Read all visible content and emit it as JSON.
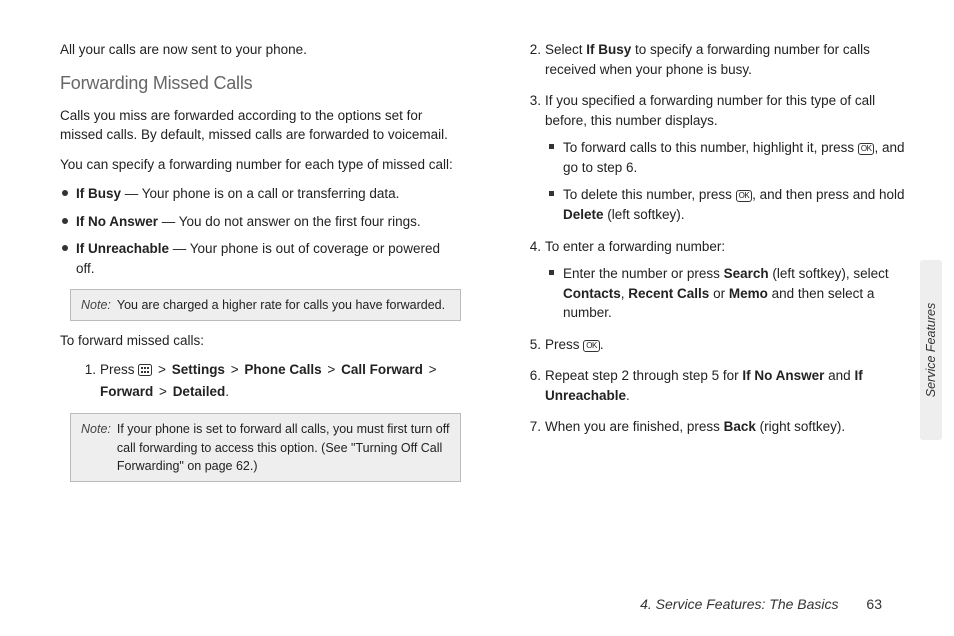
{
  "left": {
    "intro_sent": "All your calls are now sent to your phone.",
    "heading": "Forwarding Missed Calls",
    "p1": "Calls you miss are forwarded according to the options set for missed calls. By default, missed calls are forwarded to voicemail.",
    "p2": "You can specify a forwarding number for each type of missed call:",
    "b_busy_lbl": "If Busy",
    "b_busy_txt": " — Your phone is on a call or transferring data.",
    "b_noans_lbl": "If No Answer",
    "b_noans_txt": " — You do not answer on the first four rings.",
    "b_unr_lbl": "If Unreachable",
    "b_unr_txt": " — Your phone is out of coverage or powered off.",
    "note1_label": "Note:",
    "note1_text": "You are charged a higher rate for calls you have forwarded.",
    "instr": "To forward missed calls:",
    "step1_pre": "Press ",
    "nav_settings": "Settings",
    "nav_phonecalls": "Phone Calls",
    "nav_callfwd": "Call Forward",
    "nav_forward": "Forward",
    "nav_detailed": "Detailed",
    "note2_label": "Note:",
    "note2_text": "If your phone is set to forward all calls, you must first turn off call forwarding to access this option. (See \"Turning Off Call Forwarding\" on page 62.)"
  },
  "right": {
    "s2_a": "Select ",
    "s2_bold": "If Busy",
    "s2_b": " to specify a forwarding number for calls received when your phone is busy.",
    "s3": "If you specified a forwarding number for this type of call before, this number displays.",
    "s3_sub1_a": "To forward calls to this number, highlight it, press ",
    "s3_sub1_b": ", and go to step 6.",
    "s3_sub2_a": "To delete this number, press ",
    "s3_sub2_b": ", and then press and hold ",
    "s3_sub2_del": "Delete",
    "s3_sub2_c": " (left softkey).",
    "s4": "To enter a forwarding number:",
    "s4_sub_a": "Enter the number or press ",
    "s4_search": "Search",
    "s4_sub_b": " (left softkey), select ",
    "s4_contacts": "Contacts",
    "s4_recent": "Recent Calls",
    "s4_or": " or ",
    "s4_memo": "Memo",
    "s4_sub_c": " and then select a number.",
    "s5_a": "Press ",
    "s5_b": ".",
    "s6_a": "Repeat step 2 through step 5 for ",
    "s6_noans": "If No Answer",
    "s6_and": " and ",
    "s6_unr": "If Unreachable",
    "s6_b": ".",
    "s7_a": "When you are finished, press ",
    "s7_back": "Back",
    "s7_b": " (right softkey)."
  },
  "ok_label": "OK",
  "sidetab": "Service Features",
  "footer_title": "4. Service Features: The Basics",
  "footer_page": "63"
}
